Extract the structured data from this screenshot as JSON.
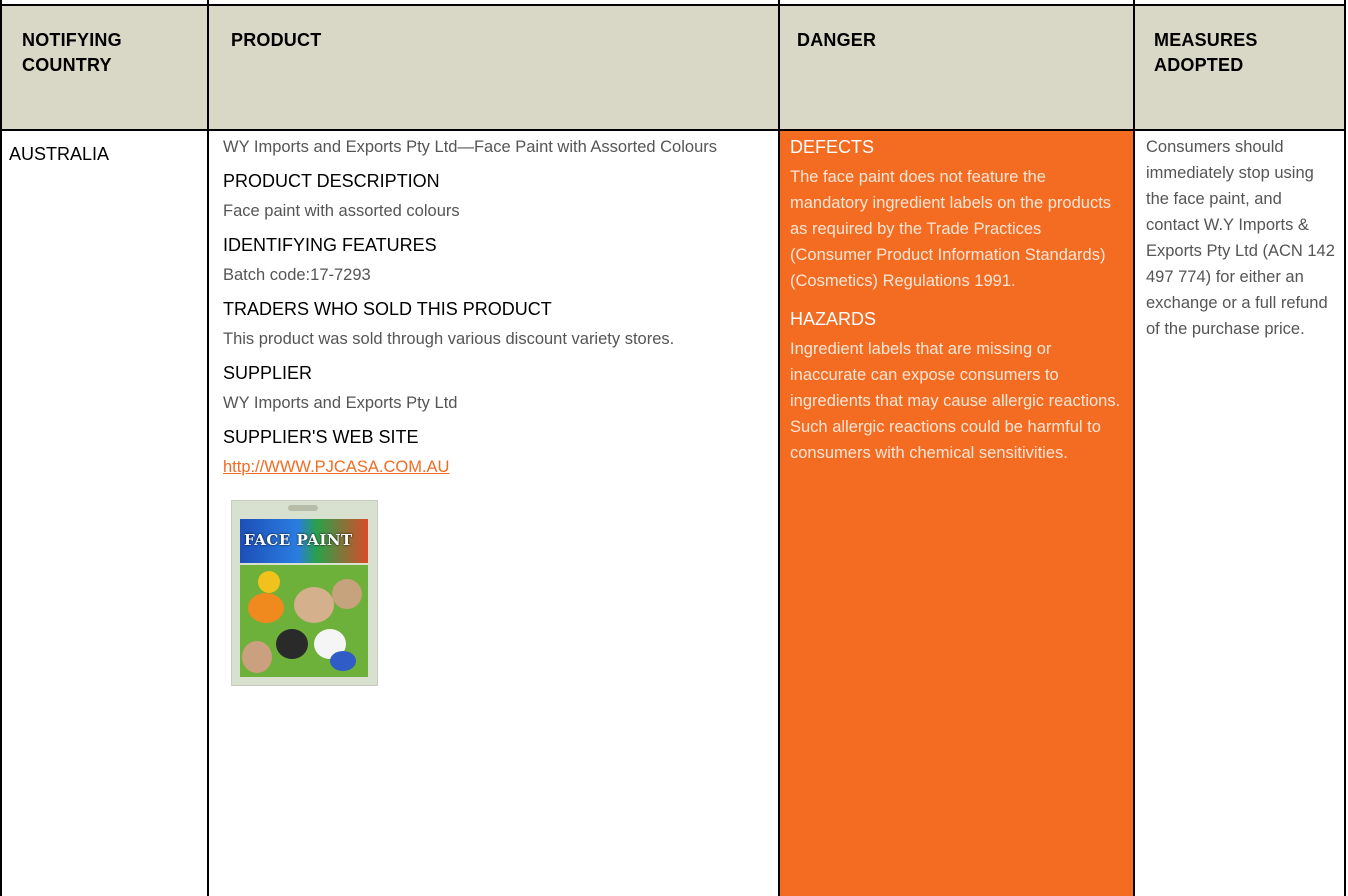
{
  "header": {
    "country": "NOTIFYING COUNTRY",
    "product": "PRODUCT",
    "danger": "DANGER",
    "measures": "MEASURES ADOPTED"
  },
  "row": {
    "country": "AUSTRALIA",
    "product": {
      "name": "WY Imports and Exports Pty Ltd—Face Paint with Assorted Colours",
      "description_title": "PRODUCT DESCRIPTION",
      "description": "Face paint with assorted colours",
      "features_title": "IDENTIFYING FEATURES",
      "features": "Batch code:17-7293",
      "traders_title": "TRADERS WHO SOLD THIS PRODUCT",
      "traders": "This product was sold through various discount variety stores.",
      "supplier_title": "SUPPLIER",
      "supplier": "WY Imports and Exports Pty Ltd",
      "website_title": "SUPPLIER'S WEB SITE",
      "website": "http://WWW.PJCASA.COM.AU",
      "image_label": "FACE PAINT"
    },
    "danger": {
      "defects_title": "DEFECTS",
      "defects": "The face paint does not feature the mandatory ingredient labels on the products as required by the Trade Practices (Consumer Product Information Standards) (Cosmetics) Regulations 1991.",
      "hazards_title": "HAZARDS",
      "hazards": "Ingredient labels that are missing or inaccurate can expose consumers to ingredients that may cause allergic reactions. Such allergic reactions could be harmful to consumers with chemical sensitivities."
    },
    "measures": "Consumers should immediately stop using the face paint, and contact W.Y Imports & Exports Pty Ltd (ACN 142 497 774) for either an exchange or a full refund of the purchase price."
  },
  "colors": {
    "header_bg": "#d9d8c6",
    "danger_bg": "#f46b22",
    "link": "#f46b22"
  }
}
